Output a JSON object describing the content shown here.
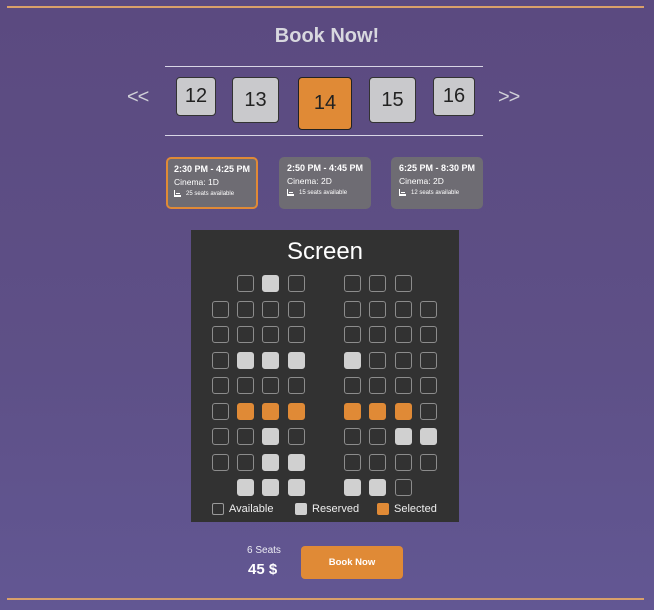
{
  "header": {
    "title": "Book Now!"
  },
  "dates": {
    "prev": "<<",
    "next": ">>",
    "items": [
      {
        "label": "12",
        "selected": false
      },
      {
        "label": "13",
        "selected": false
      },
      {
        "label": "14",
        "selected": true
      },
      {
        "label": "15",
        "selected": false
      },
      {
        "label": "16",
        "selected": false
      }
    ]
  },
  "showtimes": [
    {
      "time": "2:30 PM - 4:25 PM",
      "cinema": "Cinema: 1D",
      "seats": "25 seats available",
      "selected": true
    },
    {
      "time": "2:50 PM - 4:45 PM",
      "cinema": "Cinema: 2D",
      "seats": "15 seats available",
      "selected": false
    },
    {
      "time": "6:25 PM - 8:30 PM",
      "cinema": "Cinema: 2D",
      "seats": "12 seats available",
      "selected": false
    }
  ],
  "seatmap": {
    "screen_label": "Screen",
    "rows": [
      [
        "none",
        "available",
        "reserved",
        "available",
        "available",
        "available",
        "available",
        "none"
      ],
      [
        "available",
        "available",
        "available",
        "available",
        "available",
        "available",
        "available",
        "available"
      ],
      [
        "available",
        "available",
        "available",
        "available",
        "available",
        "available",
        "available",
        "available"
      ],
      [
        "available",
        "reserved",
        "reserved",
        "reserved",
        "reserved",
        "available",
        "available",
        "available"
      ],
      [
        "available",
        "available",
        "available",
        "available",
        "available",
        "available",
        "available",
        "available"
      ],
      [
        "available",
        "selected",
        "selected",
        "selected",
        "selected",
        "selected",
        "selected",
        "available"
      ],
      [
        "available",
        "available",
        "reserved",
        "available",
        "available",
        "available",
        "reserved",
        "reserved"
      ],
      [
        "available",
        "available",
        "reserved",
        "reserved",
        "available",
        "available",
        "available",
        "available"
      ],
      [
        "none",
        "reserved",
        "reserved",
        "reserved",
        "reserved",
        "reserved",
        "available",
        "none"
      ]
    ],
    "legend": {
      "available": "Available",
      "reserved": "Reserved",
      "selected": "Selected"
    }
  },
  "summary": {
    "seat_count": "6 Seats",
    "price": "45 $",
    "book_label": "Book Now"
  },
  "colors": {
    "accent": "#e08a36",
    "reserved": "#d0d0d0",
    "panel": "#323232"
  }
}
